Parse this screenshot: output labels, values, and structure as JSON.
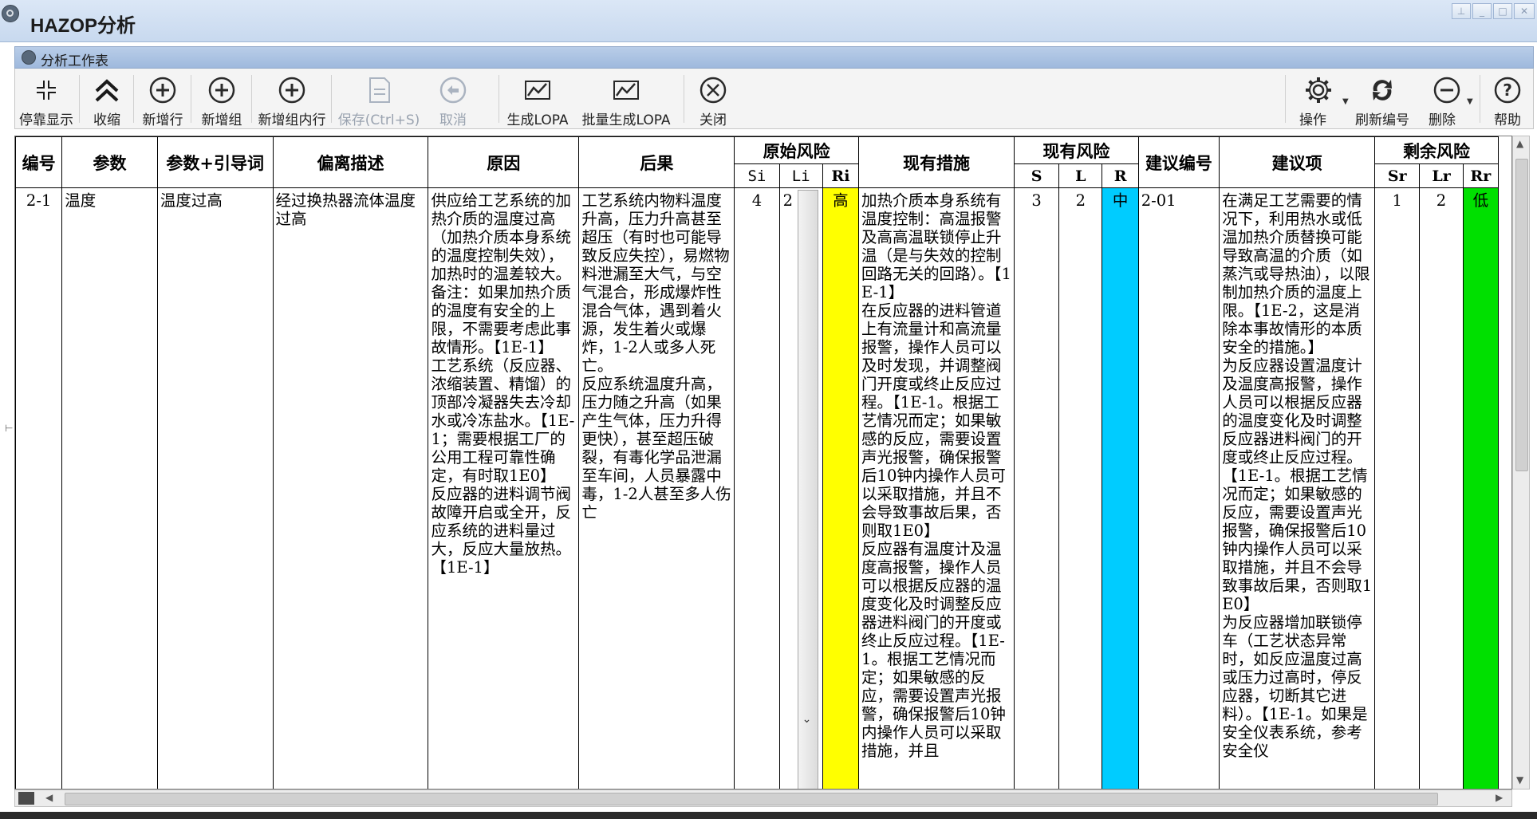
{
  "window": {
    "title": "HAZOP分析",
    "controls": [
      "pin-icon",
      "minimize-icon",
      "maximize-icon",
      "close-icon"
    ]
  },
  "panel": {
    "title": "分析工作表"
  },
  "toolbar": {
    "dock": "停靠显示",
    "collapse": "收缩",
    "add_row": "新增行",
    "add_group": "新增组",
    "add_in_group": "新增组内行",
    "save": "保存(Ctrl+S)",
    "cancel": "取消",
    "gen_lopa": "生成LOPA",
    "batch_lopa": "批量生成LOPA",
    "close": "关闭",
    "operate": "操作",
    "renumber": "刷新编号",
    "delete": "删除",
    "help": "帮助"
  },
  "grid": {
    "headers": {
      "no": "编号",
      "param": "参数",
      "param_guide": "参数+引导词",
      "deviation": "偏离描述",
      "cause": "原因",
      "consequence": "后果",
      "orig_risk": "原始风险",
      "si": "Si",
      "li": "Li",
      "ri": "Ri",
      "measures": "现有措施",
      "curr_risk": "现有风险",
      "s": "S",
      "l": "L",
      "r": "R",
      "rec_no": "建议编号",
      "recommendation": "建议项",
      "residual_risk": "剩余风险",
      "sr": "Sr",
      "lr": "Lr",
      "rr": "Rr"
    },
    "rows": [
      {
        "no": "2-1",
        "param": "温度",
        "param_guide": "温度过高",
        "deviation": "经过换热器流体温度过高",
        "cause": "供应给工艺系统的加热介质的温度过高（加热介质本身系统的温度控制失效），加热时的温差较大。备注：如果加热介质的温度有安全的上限，不需要考虑此事故情形。【1E-1】\n工艺系统（反应器、浓缩装置、精馏）的顶部冷凝器失去冷却水或冷冻盐水。【1E-1；需要根据工厂的公用工程可靠性确定，有时取1E0】\n反应器的进料调节阀故障开启或全开，反应系统的进料量过大，反应大量放热。【1E-1】",
        "consequence": "工艺系统内物料温度升高，压力升高甚至超压（有时也可能导致反应失控），易燃物料泄漏至大气，与空气混合，形成爆炸性混合气体，遇到着火源，发生着火或爆炸，1-2人或多人死亡。\n反应系统温度升高，压力随之升高（如果产生气体，压力升得更快），甚至超压破裂，有毒化学品泄漏至车间，人员暴露中毒，1-2人甚至多人伤亡",
        "si": "4",
        "li": "2",
        "ri": "高",
        "measures": "加热介质本身系统有温度控制：高温报警及高高温联锁停止升温（是与失效的控制回路无关的回路）。【1E-1】\n在反应器的进料管道上有流量计和高流量报警，操作人员可以及时发现，并调整阀门开度或终止反应过程。【1E-1。根据工艺情况而定；如果敏感的反应，需要设置声光报警，确保报警后10钟内操作人员可以采取措施，并且不会导致事故后果，否则取1E0】\n反应器有温度计及温度高报警，操作人员可以根据反应器的温度变化及时调整反应器进料阀门的开度或终止反应过程。【1E-1。根据工艺情况而定；如果敏感的反应，需要设置声光报警，确保报警后10钟内操作人员可以采取措施，并且",
        "s": "3",
        "l": "2",
        "r": "中",
        "rec_no": "2-01",
        "recommendation": "在满足工艺需要的情况下，利用热水或低温加热介质替换可能导致高温的介质（如蒸汽或导热油），以限制加热介质的温度上限。【1E-2，这是消除本事故情形的本质安全的措施。】\n为反应器设置温度计及温度高报警，操作人员可以根据反应器的温度变化及时调整反应器进料阀门的开度或终止反应过程。【1E-1。根据工艺情况而定；如果敏感的反应，需要设置声光报警，确保报警后10钟内操作人员可以采取措施，并且不会导致事故后果，否则取1E0】\n为反应器增加联锁停车（工艺状态异常时，如反应温度过高或压力过高时，停反应器，切断其它进料）。【1E-1。如果是安全仪表系统，参考安全仪",
        "sr": "1",
        "lr": "2",
        "rr": "低"
      }
    ]
  },
  "colors": {
    "risk_high": "#ffff00",
    "risk_medium": "#00ccff",
    "risk_low": "#00e000"
  }
}
